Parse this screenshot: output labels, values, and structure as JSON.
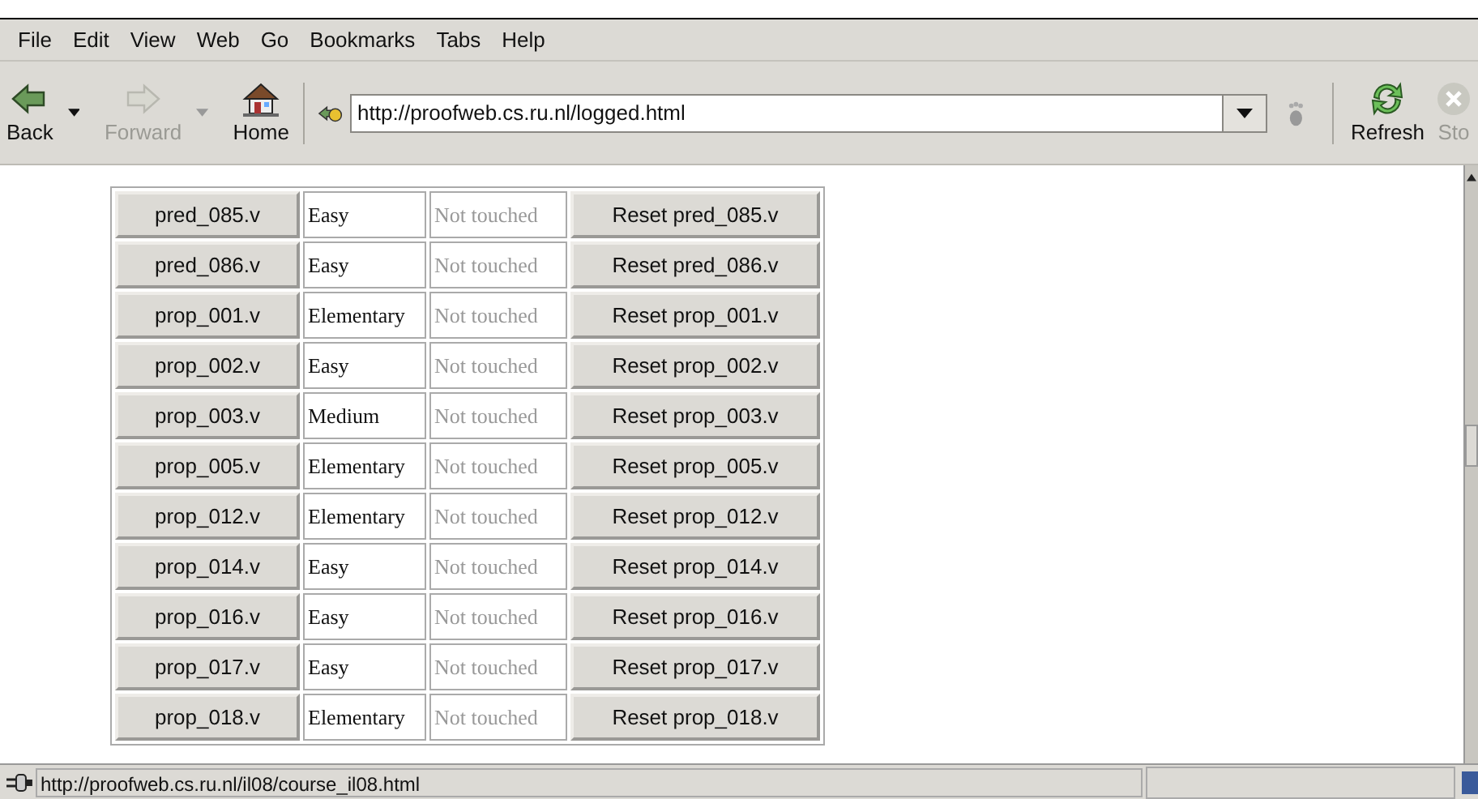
{
  "menu": [
    "File",
    "Edit",
    "View",
    "Web",
    "Go",
    "Bookmarks",
    "Tabs",
    "Help"
  ],
  "toolbar": [
    {
      "kind": "back",
      "label": "Back",
      "disabled": false
    },
    {
      "kind": "forward",
      "label": "Forward",
      "disabled": true
    },
    {
      "kind": "home",
      "label": "Home",
      "disabled": false
    }
  ],
  "address": {
    "value": "http://proofweb.cs.ru.nl/logged.html"
  },
  "toolbar_right": [
    {
      "kind": "refresh",
      "label": "Refresh",
      "disabled": false
    },
    {
      "kind": "stop",
      "label": "Sto",
      "disabled": true
    }
  ],
  "rows": [
    {
      "exercise": "pred_085.v",
      "difficulty": "Easy",
      "status": "Not touched",
      "reset": "Reset pred_085.v"
    },
    {
      "exercise": "pred_086.v",
      "difficulty": "Easy",
      "status": "Not touched",
      "reset": "Reset pred_086.v"
    },
    {
      "exercise": "prop_001.v",
      "difficulty": "Elementary",
      "status": "Not touched",
      "reset": "Reset prop_001.v"
    },
    {
      "exercise": "prop_002.v",
      "difficulty": "Easy",
      "status": "Not touched",
      "reset": "Reset prop_002.v"
    },
    {
      "exercise": "prop_003.v",
      "difficulty": "Medium",
      "status": "Not touched",
      "reset": "Reset prop_003.v"
    },
    {
      "exercise": "prop_005.v",
      "difficulty": "Elementary",
      "status": "Not touched",
      "reset": "Reset prop_005.v"
    },
    {
      "exercise": "prop_012.v",
      "difficulty": "Elementary",
      "status": "Not touched",
      "reset": "Reset prop_012.v"
    },
    {
      "exercise": "prop_014.v",
      "difficulty": "Easy",
      "status": "Not touched",
      "reset": "Reset prop_014.v"
    },
    {
      "exercise": "prop_016.v",
      "difficulty": "Easy",
      "status": "Not touched",
      "reset": "Reset prop_016.v"
    },
    {
      "exercise": "prop_017.v",
      "difficulty": "Easy",
      "status": "Not touched",
      "reset": "Reset prop_017.v"
    },
    {
      "exercise": "prop_018.v",
      "difficulty": "Elementary",
      "status": "Not touched",
      "reset": "Reset prop_018.v"
    }
  ],
  "status_bar": {
    "text": "http://proofweb.cs.ru.nl/il08/course_il08.html"
  }
}
